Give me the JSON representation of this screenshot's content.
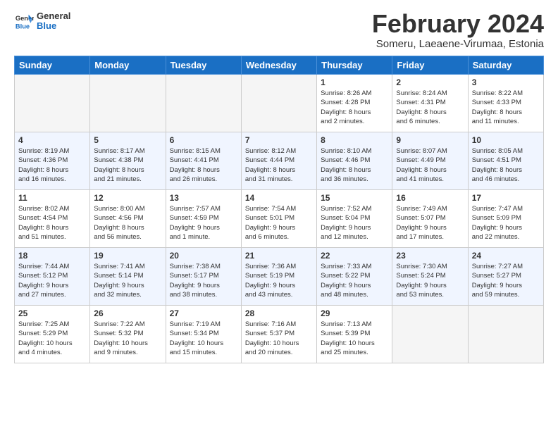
{
  "logo": {
    "line1": "General",
    "line2": "Blue"
  },
  "title": "February 2024",
  "location": "Someru, Laeaene-Virumaa, Estonia",
  "days_of_week": [
    "Sunday",
    "Monday",
    "Tuesday",
    "Wednesday",
    "Thursday",
    "Friday",
    "Saturday"
  ],
  "weeks": [
    {
      "shade": false,
      "days": [
        {
          "num": "",
          "info": ""
        },
        {
          "num": "",
          "info": ""
        },
        {
          "num": "",
          "info": ""
        },
        {
          "num": "",
          "info": ""
        },
        {
          "num": "1",
          "info": "Sunrise: 8:26 AM\nSunset: 4:28 PM\nDaylight: 8 hours\nand 2 minutes."
        },
        {
          "num": "2",
          "info": "Sunrise: 8:24 AM\nSunset: 4:31 PM\nDaylight: 8 hours\nand 6 minutes."
        },
        {
          "num": "3",
          "info": "Sunrise: 8:22 AM\nSunset: 4:33 PM\nDaylight: 8 hours\nand 11 minutes."
        }
      ]
    },
    {
      "shade": true,
      "days": [
        {
          "num": "4",
          "info": "Sunrise: 8:19 AM\nSunset: 4:36 PM\nDaylight: 8 hours\nand 16 minutes."
        },
        {
          "num": "5",
          "info": "Sunrise: 8:17 AM\nSunset: 4:38 PM\nDaylight: 8 hours\nand 21 minutes."
        },
        {
          "num": "6",
          "info": "Sunrise: 8:15 AM\nSunset: 4:41 PM\nDaylight: 8 hours\nand 26 minutes."
        },
        {
          "num": "7",
          "info": "Sunrise: 8:12 AM\nSunset: 4:44 PM\nDaylight: 8 hours\nand 31 minutes."
        },
        {
          "num": "8",
          "info": "Sunrise: 8:10 AM\nSunset: 4:46 PM\nDaylight: 8 hours\nand 36 minutes."
        },
        {
          "num": "9",
          "info": "Sunrise: 8:07 AM\nSunset: 4:49 PM\nDaylight: 8 hours\nand 41 minutes."
        },
        {
          "num": "10",
          "info": "Sunrise: 8:05 AM\nSunset: 4:51 PM\nDaylight: 8 hours\nand 46 minutes."
        }
      ]
    },
    {
      "shade": false,
      "days": [
        {
          "num": "11",
          "info": "Sunrise: 8:02 AM\nSunset: 4:54 PM\nDaylight: 8 hours\nand 51 minutes."
        },
        {
          "num": "12",
          "info": "Sunrise: 8:00 AM\nSunset: 4:56 PM\nDaylight: 8 hours\nand 56 minutes."
        },
        {
          "num": "13",
          "info": "Sunrise: 7:57 AM\nSunset: 4:59 PM\nDaylight: 9 hours\nand 1 minute."
        },
        {
          "num": "14",
          "info": "Sunrise: 7:54 AM\nSunset: 5:01 PM\nDaylight: 9 hours\nand 6 minutes."
        },
        {
          "num": "15",
          "info": "Sunrise: 7:52 AM\nSunset: 5:04 PM\nDaylight: 9 hours\nand 12 minutes."
        },
        {
          "num": "16",
          "info": "Sunrise: 7:49 AM\nSunset: 5:07 PM\nDaylight: 9 hours\nand 17 minutes."
        },
        {
          "num": "17",
          "info": "Sunrise: 7:47 AM\nSunset: 5:09 PM\nDaylight: 9 hours\nand 22 minutes."
        }
      ]
    },
    {
      "shade": true,
      "days": [
        {
          "num": "18",
          "info": "Sunrise: 7:44 AM\nSunset: 5:12 PM\nDaylight: 9 hours\nand 27 minutes."
        },
        {
          "num": "19",
          "info": "Sunrise: 7:41 AM\nSunset: 5:14 PM\nDaylight: 9 hours\nand 32 minutes."
        },
        {
          "num": "20",
          "info": "Sunrise: 7:38 AM\nSunset: 5:17 PM\nDaylight: 9 hours\nand 38 minutes."
        },
        {
          "num": "21",
          "info": "Sunrise: 7:36 AM\nSunset: 5:19 PM\nDaylight: 9 hours\nand 43 minutes."
        },
        {
          "num": "22",
          "info": "Sunrise: 7:33 AM\nSunset: 5:22 PM\nDaylight: 9 hours\nand 48 minutes."
        },
        {
          "num": "23",
          "info": "Sunrise: 7:30 AM\nSunset: 5:24 PM\nDaylight: 9 hours\nand 53 minutes."
        },
        {
          "num": "24",
          "info": "Sunrise: 7:27 AM\nSunset: 5:27 PM\nDaylight: 9 hours\nand 59 minutes."
        }
      ]
    },
    {
      "shade": false,
      "days": [
        {
          "num": "25",
          "info": "Sunrise: 7:25 AM\nSunset: 5:29 PM\nDaylight: 10 hours\nand 4 minutes."
        },
        {
          "num": "26",
          "info": "Sunrise: 7:22 AM\nSunset: 5:32 PM\nDaylight: 10 hours\nand 9 minutes."
        },
        {
          "num": "27",
          "info": "Sunrise: 7:19 AM\nSunset: 5:34 PM\nDaylight: 10 hours\nand 15 minutes."
        },
        {
          "num": "28",
          "info": "Sunrise: 7:16 AM\nSunset: 5:37 PM\nDaylight: 10 hours\nand 20 minutes."
        },
        {
          "num": "29",
          "info": "Sunrise: 7:13 AM\nSunset: 5:39 PM\nDaylight: 10 hours\nand 25 minutes."
        },
        {
          "num": "",
          "info": ""
        },
        {
          "num": "",
          "info": ""
        }
      ]
    }
  ]
}
